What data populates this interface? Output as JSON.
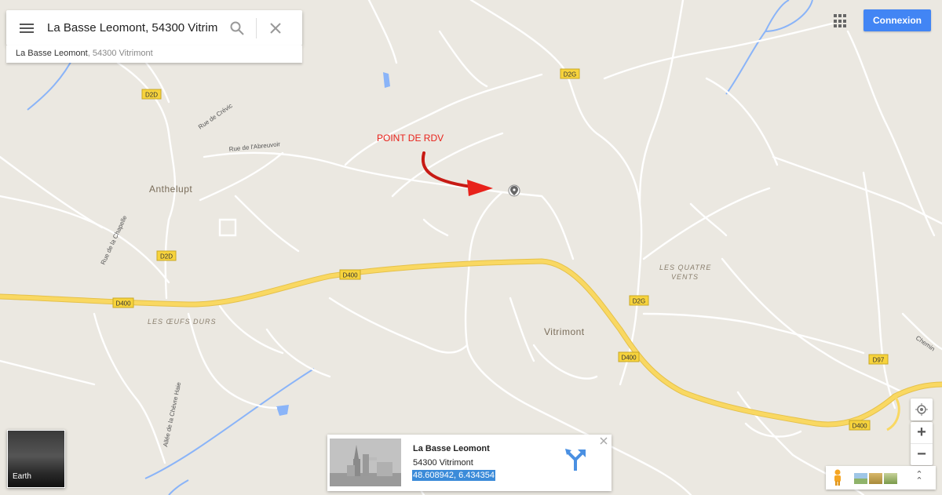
{
  "search": {
    "value": "La Basse Leomont, 54300 Vitrimont",
    "suggestion_main": "La Basse Leomont",
    "suggestion_sub": ", 54300 Vitrimont"
  },
  "header": {
    "connect_label": "Connexion"
  },
  "annotation": {
    "text": "POINT DE RDV",
    "color": "#e8221b"
  },
  "map_labels": {
    "anthelupt": "Anthelupt",
    "vitrimont": "Vitrimont",
    "les_quatre": "LES QUATRE",
    "vents": "VENTS",
    "les_oeufs_durs": "LES ŒUFS DURS",
    "rue_crevic": "Rue de Crévic",
    "rue_abreuvoir": "Rue de l'Abreuvoir",
    "rue_chapelle": "Rue de la Chapelle",
    "allee_chevre": "Allée de la Chèvre Haie",
    "chemin": "Chemin"
  },
  "route_shields": {
    "d2d": "D2D",
    "d2g": "D2G",
    "d400": "D400",
    "d97": "D97"
  },
  "earth_label": "Earth",
  "place_card": {
    "title": "La Basse Leomont",
    "line2": "54300 Vitrimont",
    "coords": "48.608942, 6.434354"
  },
  "controls": {
    "zoom_in": "+",
    "zoom_out": "−"
  },
  "colors": {
    "map_bg": "#ebe8e1",
    "road_main": "#f6cf55",
    "road_minor": "#ffffff",
    "water": "#7aaee8",
    "accent": "#4285f4",
    "shield": "#f7d33c"
  }
}
